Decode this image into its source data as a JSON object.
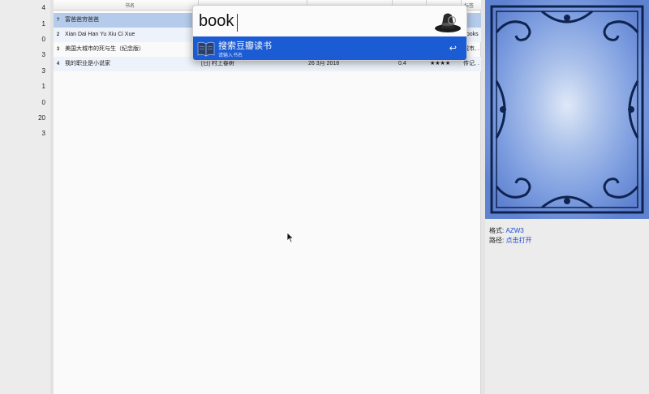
{
  "left_counts": [
    "4",
    "1",
    "0",
    "3",
    "3",
    "1",
    "0",
    "20",
    "3"
  ],
  "table": {
    "headers": [
      "书名",
      "",
      "",
      "",
      "",
      "",
      "标签"
    ],
    "rows": [
      {
        "num": "?",
        "title": "富爸爸穷爸爸",
        "author": "",
        "date": "",
        "size": "",
        "rating": "",
        "tags": "",
        "selected": true
      },
      {
        "num": "2",
        "title": "Xian Dai Han Yu Xiu Ci Xue",
        "author": "",
        "date": "",
        "size": "",
        "rating": "",
        "tags": "books"
      },
      {
        "num": "3",
        "title": "美国大城市的死与生（纪念版）",
        "author": "",
        "date": "",
        "size": "",
        "rating": "",
        "tags": "城市, ."
      },
      {
        "num": "4",
        "title": "我的职业是小说家",
        "author": "[日] 村上春树",
        "date": "26 3月 2018",
        "size": "0.4",
        "rating": "★★★★",
        "tags": "传记, ."
      }
    ]
  },
  "search": {
    "query": "book",
    "result_title": "搜索豆瓣读书",
    "result_subtitle": "请输入书名",
    "return_symbol": "↩",
    "icon": "alfred-hat-icon",
    "result_icon": "open-book-icon"
  },
  "details": {
    "format_label": "格式:",
    "format_value": "AZW3",
    "path_label": "路径:",
    "path_value": "点击打开"
  },
  "colors": {
    "selection": "#b4cbeb",
    "result_highlight": "#1b5bd3",
    "cover_bg": "#6d8fd6",
    "link": "#1a4ad0"
  }
}
